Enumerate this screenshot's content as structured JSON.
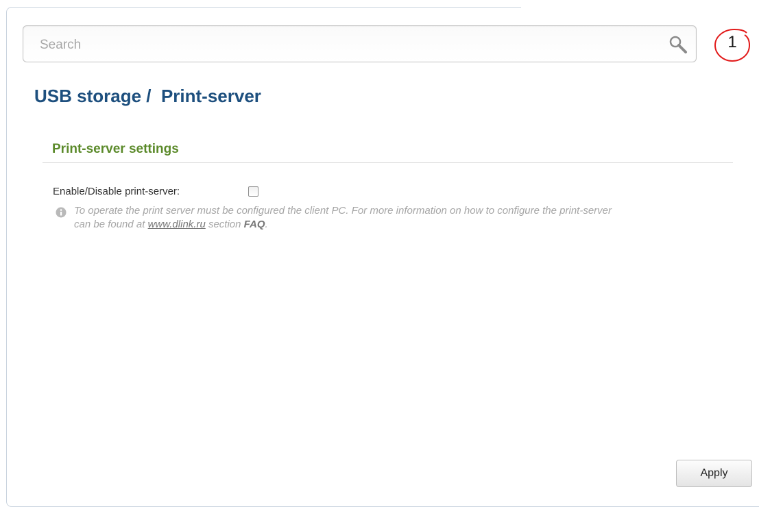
{
  "search": {
    "placeholder": "Search",
    "value": ""
  },
  "notifications": {
    "count": "1",
    "color": "#e21b1b"
  },
  "page": {
    "breadcrumb_parent": "USB storage",
    "separator": " /  ",
    "title": "Print-server"
  },
  "section": {
    "title": "Print-server settings"
  },
  "form": {
    "enable_label": "Enable/Disable print-server:",
    "enable_checked": false
  },
  "hint": {
    "text_1": "To operate the print server must be configured the client PC. For more information on how to configure the print-server can be found at ",
    "link": "www.dlink.ru",
    "text_2": " section ",
    "faq": "FAQ",
    "text_3": "."
  },
  "actions": {
    "apply_label": "Apply"
  },
  "colors": {
    "title": "#1d4f7e",
    "section_title": "#5b8a2a",
    "notification": "#e21b1b"
  }
}
